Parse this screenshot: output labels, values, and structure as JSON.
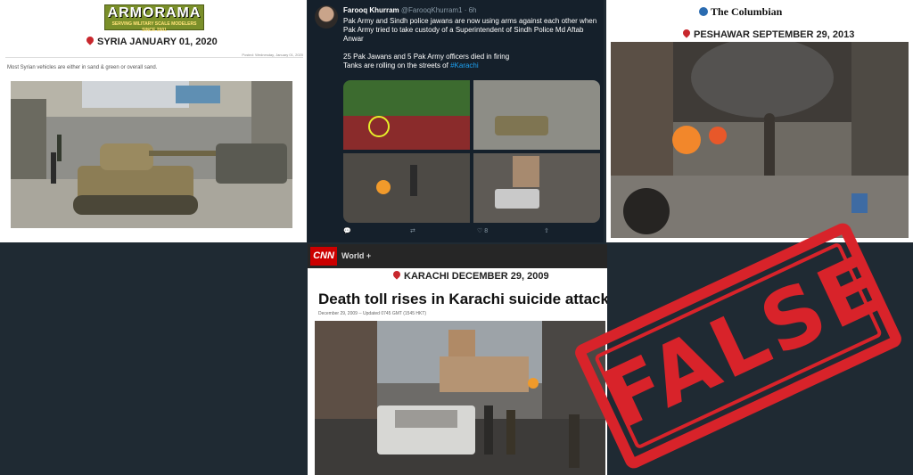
{
  "armorama": {
    "logo_text": "ARMORAMA",
    "logo_sub": "SERVING MILITARY SCALE MODELERS SINCE 2001",
    "location": "SYRIA JANUARY 01, 2020",
    "posted": "Posted: Wednesday, January 01, 2020",
    "caption": "Most Syrian vehicles are either in sand & green or overall sand."
  },
  "tweet": {
    "name": "Farooq Khurram",
    "handle": "@FarooqKhurram1 · 6h",
    "text": "Pak Army and Sindh police jawans are now using arms against each other when Pak Army tried to take custody of a Superintendent of Sindh Police Md Aftab Anwar\n\n25 Pak Jawans and 5 Pak Army officers died in firing\nTanks are rolling on the streets of",
    "hashtag": "#Karachi",
    "likes": "8"
  },
  "columbian": {
    "logo": "The Columbian",
    "location": "PESHAWAR SEPTEMBER 29, 2013"
  },
  "cnn": {
    "logo": "CNN",
    "section": "World +",
    "location": "KARACHI DECEMBER 29, 2009",
    "headline": "Death toll rises in Karachi suicide attack",
    "dateline": "December 29, 2009 -- Updated 0745 GMT (1545 HKT)"
  },
  "stamp": {
    "text": "FALSE"
  },
  "colors": {
    "stamp_red": "#d8232a",
    "pin_red": "#c8272d",
    "twitter_bg": "#15202b",
    "page_bg": "#1f2a33"
  }
}
